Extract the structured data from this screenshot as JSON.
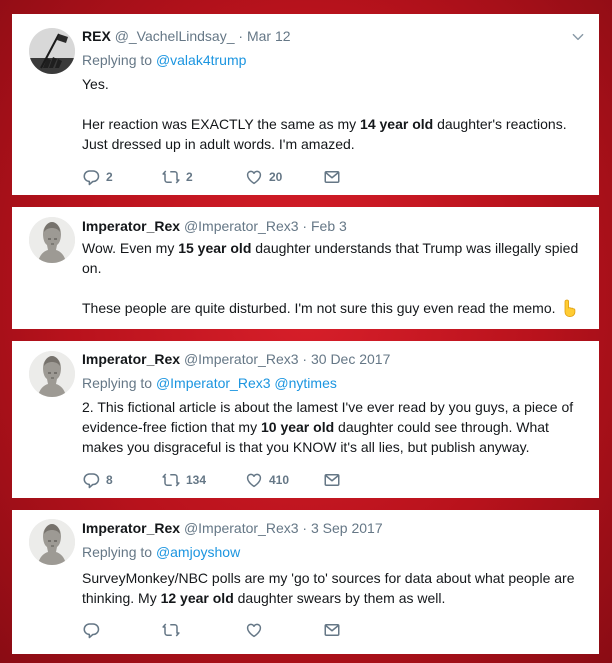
{
  "tweets": [
    {
      "name": "REX",
      "handle": "@_VachelLindsay_",
      "date": "Mar 12",
      "replying_prefix": "Replying to ",
      "replying_to": "@valak4trump",
      "line1": "Yes.",
      "line2_pre": "Her reaction was EXACTLY the same as my ",
      "line2_bold": "14 year old",
      "line2_post": " daughter's reactions.",
      "line3": "Just dressed up in adult words. I'm amazed.",
      "replies": "2",
      "retweets": "2",
      "likes": "20"
    },
    {
      "name": "Imperator_Rex",
      "handle": "@Imperator_Rex3",
      "date": "Feb 3",
      "line1_pre": "Wow. Even my ",
      "line1_bold": "15 year old",
      "line1_post": " daughter understands that Trump was illegally spied on.",
      "line2": "These people are quite disturbed. I'm not sure this guy even read the memo."
    },
    {
      "name": "Imperator_Rex",
      "handle": "@Imperator_Rex3",
      "date": "30 Dec 2017",
      "replying_prefix": "Replying to ",
      "replying_to": "@Imperator_Rex3 @nytimes",
      "text_pre": "2. This fictional article is about the lamest I've ever read by you guys, a piece of evidence-free fiction that my ",
      "text_bold": "10 year old",
      "text_post": " daughter could see through. What makes you disgraceful is that you KNOW it's all lies, but publish anyway.",
      "replies": "8",
      "retweets": "134",
      "likes": "410"
    },
    {
      "name": "Imperator_Rex",
      "handle": "@Imperator_Rex3",
      "date": "3 Sep 2017",
      "replying_prefix": "Replying to ",
      "replying_to": "@amjoyshow",
      "text_pre": "SurveyMonkey/NBC polls are my 'go to' sources for data about what people are thinking. My ",
      "text_bold": "12 year old",
      "text_post": " daughter swears by them as well."
    }
  ],
  "dot": "·",
  "icons": [
    "reply-icon",
    "retweet-icon",
    "like-icon",
    "dm-icon",
    "caret-down-icon",
    "point-down-emoji"
  ],
  "colors": {
    "link": "#1b95e0",
    "muted": "#657786",
    "text": "#14171a",
    "background": "#c8141f"
  }
}
